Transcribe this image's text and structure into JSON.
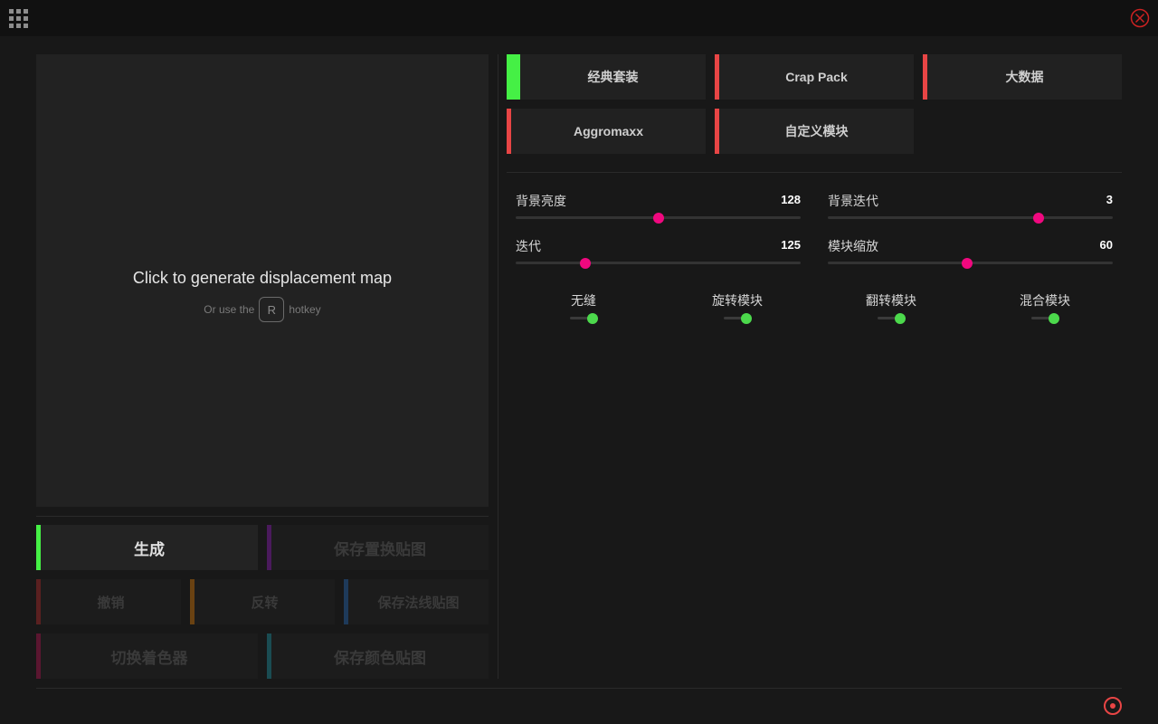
{
  "colors": {
    "accent_pink": "#f0087f",
    "toggle_green": "#4cd94c",
    "selected_preset": "#45f045",
    "preset_red": "#e84545",
    "close_red": "#cc2222"
  },
  "icons": {
    "menu": "grid-icon",
    "close": "close-icon",
    "target": "target-icon"
  },
  "preview": {
    "title": "Click to generate displacement map",
    "hint_before": "Or use the",
    "hotkey": "R",
    "hint_after": "hotkey"
  },
  "actions": {
    "generate": "生成",
    "save_displacement": "保存置换贴图",
    "undo": "撤销",
    "invert": "反转",
    "save_normal": "保存法线贴图",
    "switch_shader": "切换着色器",
    "save_color": "保存颜色贴图"
  },
  "presets": [
    {
      "label": "经典套装",
      "selected": true
    },
    {
      "label": "Crap Pack",
      "selected": false
    },
    {
      "label": "大数据",
      "selected": false
    },
    {
      "label": "Aggromaxx",
      "selected": false
    },
    {
      "label": "自定义模块",
      "selected": false
    }
  ],
  "sliders": [
    {
      "label": "背景亮度",
      "value": "128",
      "fraction": 0.5
    },
    {
      "label": "背景迭代",
      "value": "3",
      "fraction": 0.74
    },
    {
      "label": "迭代",
      "value": "125",
      "fraction": 0.245
    },
    {
      "label": "模块缩放",
      "value": "60",
      "fraction": 0.49
    }
  ],
  "toggles": [
    {
      "label": "无缝",
      "on": true
    },
    {
      "label": "旋转模块",
      "on": true
    },
    {
      "label": "翻转模块",
      "on": true
    },
    {
      "label": "混合模块",
      "on": true
    }
  ]
}
